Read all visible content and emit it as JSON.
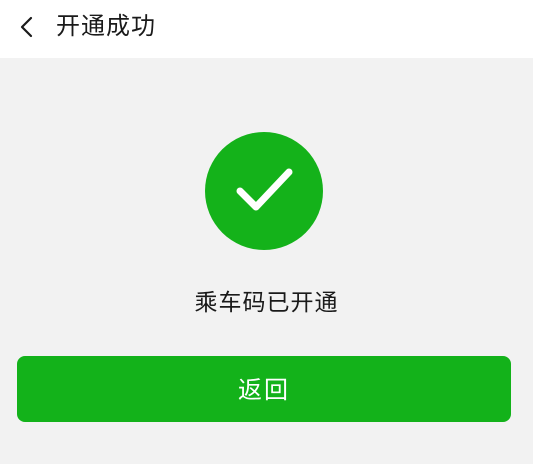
{
  "header": {
    "title": "开通成功",
    "back_icon": "chevron-left-icon"
  },
  "result": {
    "icon": "check-circle-icon",
    "icon_color": "#14b21a",
    "message": "乘车码已开通"
  },
  "actions": {
    "return_label": "返回",
    "return_color": "#13b21a"
  }
}
